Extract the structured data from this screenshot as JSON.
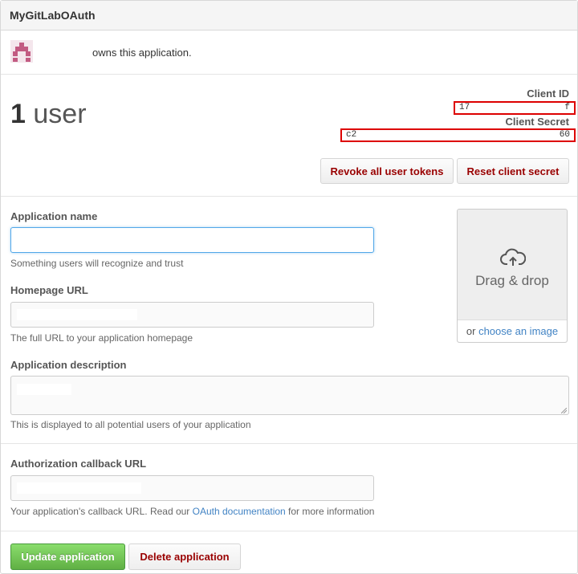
{
  "header": {
    "title": "MyGitLabOAuth"
  },
  "owner": {
    "text": "owns this application."
  },
  "stats": {
    "user_count": "1",
    "user_label": "user"
  },
  "keys": {
    "client_id_label": "Client ID",
    "client_id_start": "17",
    "client_id_end": "f",
    "client_secret_label": "Client Secret",
    "client_secret_start": "c2",
    "client_secret_end": "60"
  },
  "actions": {
    "revoke_label": "Revoke all user tokens",
    "reset_label": "Reset client secret"
  },
  "form": {
    "app_name_label": "Application name",
    "app_name_value": "",
    "app_name_hint": "Something users will recognize and trust",
    "homepage_label": "Homepage URL",
    "homepage_value": "",
    "homepage_hint": "The full URL to your application homepage",
    "description_label": "Application description",
    "description_value": "",
    "description_hint": "This is displayed to all potential users of your application",
    "callback_label": "Authorization callback URL",
    "callback_value": "",
    "callback_hint_pre": "Your application's callback URL. Read our ",
    "callback_hint_link": "OAuth documentation",
    "callback_hint_post": " for more information"
  },
  "dropzone": {
    "icon": "cloud-upload-icon",
    "text": "Drag & drop",
    "or_text": "or ",
    "choose_link": "choose an image"
  },
  "footer": {
    "update_label": "Update application",
    "delete_label": "Delete application"
  },
  "colors": {
    "primary_green": "#60b044",
    "danger_text": "#990000",
    "link_blue": "#4183c4",
    "highlight_red": "#dd0000"
  }
}
